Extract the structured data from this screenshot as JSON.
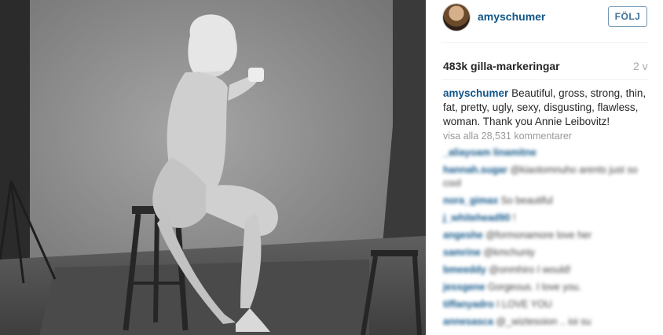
{
  "header": {
    "username": "amyschumer",
    "follow_label": "FÖLJ"
  },
  "stats": {
    "likes": "483k gilla-markeringar",
    "age": "2 v"
  },
  "caption": {
    "username": "amyschumer",
    "text": "Beautiful, gross, strong, thin, fat, pretty, ugly, sexy, disgusting, flawless, woman. Thank you Annie Leibovitz!"
  },
  "view_all": "visa alla 28,531 kommentarer",
  "comments": [
    {
      "user": "_aliayoam linamitne",
      "text": ""
    },
    {
      "user": "hannah.sugar",
      "text": "@kiaotomnuho arents just so cool"
    },
    {
      "user": "nora_gimax",
      "text": "So beautiful"
    },
    {
      "user": "j_whitehead90",
      "text": "!"
    },
    {
      "user": "angeshe",
      "text": "@formonamore love her"
    },
    {
      "user": "samrine",
      "text": "@kmchuniy"
    },
    {
      "user": "bmeeddy",
      "text": "@onmhiro I would!"
    },
    {
      "user": "jessgene",
      "text": "Gorgeous. I love you."
    },
    {
      "user": "tiffanyadro",
      "text": "I LOVE YOU"
    },
    {
      "user": "annesasca",
      "text": "@_wiztesoion .. ioi su"
    }
  ],
  "colors": {
    "link": "#125688",
    "follow_border": "#6f97b6",
    "muted": "#999999"
  }
}
